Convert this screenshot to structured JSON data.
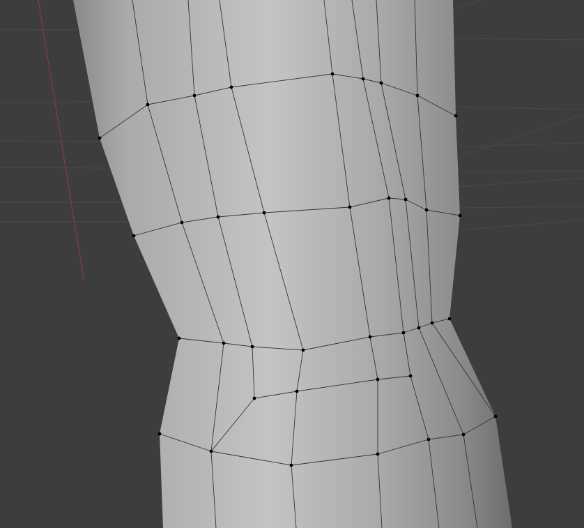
{
  "viewport": {
    "background_color": "#3d3d3d",
    "grid_line_color": "#4a4a4a",
    "axis_line_color": "#8e3a3a",
    "mesh_fill_light": "#c4c6c6",
    "mesh_fill_dark": "#6f6f6f",
    "wire_color": "#333333",
    "vertex_color": "#000000",
    "object": "subdivided-mesh-object",
    "mode": "edit-mode-vertex-select"
  }
}
